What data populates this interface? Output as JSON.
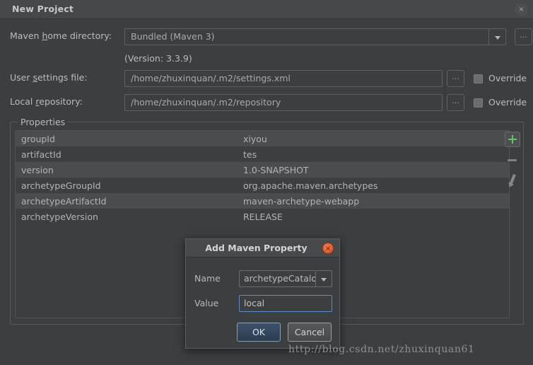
{
  "window": {
    "title": "New Project",
    "close_icon": "close-icon",
    "close_glyph": "×"
  },
  "form": {
    "maven_home": {
      "label_pre": "Maven ",
      "label_mnemonic": "h",
      "label_post": "ome directory:",
      "value": "Bundled (Maven 3)",
      "dropdown_icon": "chevron-down-icon",
      "browse_label": "..."
    },
    "version_note": "(Version: 3.3.9)",
    "user_settings": {
      "label_pre": "User ",
      "label_mnemonic": "s",
      "label_post": "ettings file:",
      "value": "/home/zhuxinquan/.m2/settings.xml",
      "browse_label": "...",
      "override_label": "Override",
      "override_checked": false
    },
    "local_repository": {
      "label_pre": "Local ",
      "label_mnemonic": "r",
      "label_post": "epository:",
      "value": "/home/zhuxinquan/.m2/repository",
      "browse_label": "...",
      "override_label": "Override",
      "override_checked": false
    }
  },
  "properties": {
    "group_title": "Properties",
    "rows": [
      {
        "key": "groupId",
        "value": "xiyou"
      },
      {
        "key": "artifactId",
        "value": "tes"
      },
      {
        "key": "version",
        "value": "1.0-SNAPSHOT"
      },
      {
        "key": "archetypeGroupId",
        "value": "org.apache.maven.archetypes"
      },
      {
        "key": "archetypeArtifactId",
        "value": "maven-archetype-webapp"
      },
      {
        "key": "archetypeVersion",
        "value": "RELEASE"
      }
    ],
    "tools": {
      "add_icon": "plus-icon",
      "remove_icon": "minus-icon",
      "edit_icon": "pencil-icon",
      "add_color": "#62c462"
    }
  },
  "modal": {
    "title": "Add Maven Property",
    "close_icon": "close-icon",
    "close_glyph": "×",
    "name_label": "Name",
    "name_value": "archetypeCatalog",
    "name_dropdown_icon": "chevron-down-icon",
    "value_label": "Value",
    "value_value": "local",
    "ok_label": "OK",
    "cancel_label": "Cancel",
    "focus_color": "#5f8ec4"
  },
  "watermark": {
    "text": "http://blog.csdn.net/zhuxinquan61"
  }
}
